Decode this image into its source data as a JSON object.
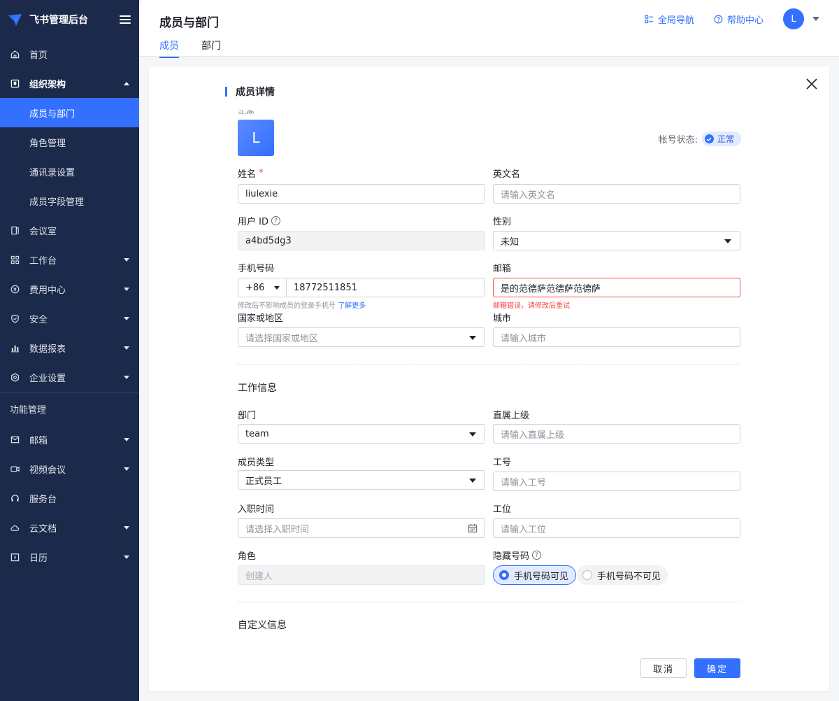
{
  "sidebar": {
    "brand": "飞书管理后台",
    "items": [
      {
        "label": "首页"
      },
      {
        "label": "组织架构"
      },
      {
        "label": "成员与部门"
      },
      {
        "label": "角色管理"
      },
      {
        "label": "通讯录设置"
      },
      {
        "label": "成员字段管理"
      },
      {
        "label": "会议室"
      },
      {
        "label": "工作台"
      },
      {
        "label": "费用中心"
      },
      {
        "label": "安全"
      },
      {
        "label": "数据报表"
      },
      {
        "label": "企业设置"
      }
    ],
    "section_title": "功能管理",
    "feature_items": [
      {
        "label": "邮箱"
      },
      {
        "label": "视频会议"
      },
      {
        "label": "服务台"
      },
      {
        "label": "云文档"
      },
      {
        "label": "日历"
      }
    ]
  },
  "header": {
    "title": "成员与部门",
    "tabs": [
      {
        "label": "成员"
      },
      {
        "label": "部门"
      }
    ],
    "global_nav": "全局导航",
    "help_center": "帮助中心",
    "avatar_initial": "L"
  },
  "detail": {
    "section_title": "成员详情",
    "avatar_label": "头像",
    "avatar_initial": "L",
    "account_status_label": "帐号状态:",
    "account_status": "正常",
    "name_label": "姓名",
    "name_required": "*",
    "name_value": "liulexie",
    "en_name_label": "英文名",
    "en_name_placeholder": "请输入英文名",
    "user_id_label": "用户 ID",
    "user_id_value": "a4bd5dg3",
    "gender_label": "性别",
    "gender_value": "未知",
    "phone_label": "手机号码",
    "phone_prefix": "+86",
    "phone_value": "18772511851",
    "phone_hint": "修改后不影响成员的登录手机号",
    "phone_hint_link": "了解更多",
    "email_label": "邮箱",
    "email_value": "是的范德萨范德萨范德萨",
    "email_error": "邮箱错误，请修改后重试",
    "country_label": "国家或地区",
    "country_placeholder": "请选择国家或地区",
    "city_label": "城市",
    "city_placeholder": "请输入城市"
  },
  "work": {
    "title": "工作信息",
    "dept_label": "部门",
    "dept_value": "team",
    "manager_label": "直属上级",
    "manager_placeholder": "请输入直属上级",
    "type_label": "成员类型",
    "type_value": "正式员工",
    "employee_no_label": "工号",
    "employee_no_placeholder": "请输入工号",
    "join_label": "入职时间",
    "join_placeholder": "请选择入职时间",
    "seat_label": "工位",
    "seat_placeholder": "请输入工位",
    "role_label": "角色",
    "role_value": "创建人",
    "hide_phone_label": "隐藏号码",
    "radio_visible": "手机号码可见",
    "radio_hidden": "手机号码不可见"
  },
  "custom": {
    "title": "自定义信息"
  },
  "footer": {
    "cancel": "取消",
    "confirm": "确定"
  }
}
